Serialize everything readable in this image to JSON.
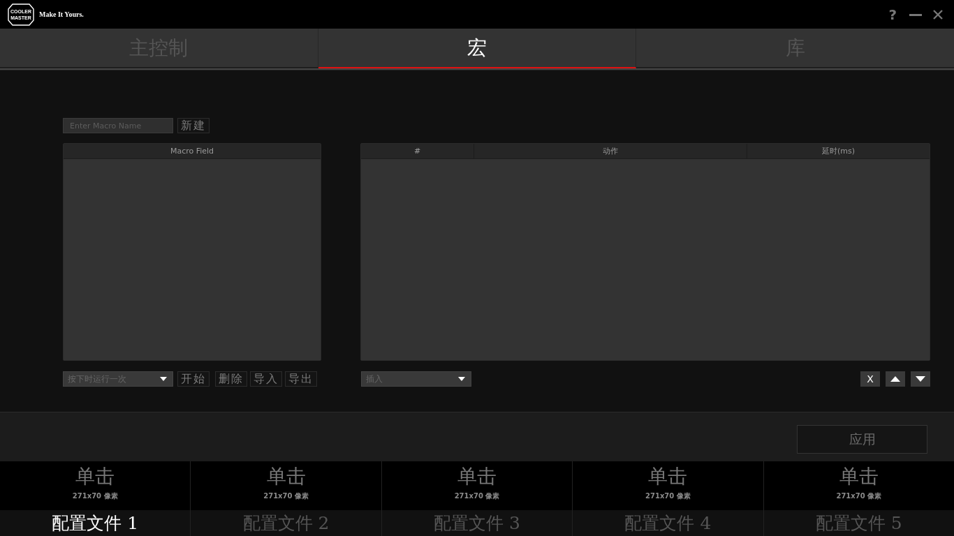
{
  "title_bar": {
    "logo_lines": [
      "COOLER",
      "MASTER"
    ],
    "slogan": "Make It Yours.",
    "help": "?"
  },
  "tabs": [
    {
      "label": "主控制",
      "selected": false
    },
    {
      "label": "宏",
      "selected": true
    },
    {
      "label": "库",
      "selected": false
    }
  ],
  "macro_name": {
    "placeholder": "Enter Macro Name"
  },
  "new_button": "新建",
  "macro_field": {
    "header": "Macro Field"
  },
  "run_mode": {
    "value": "按下时运行一次"
  },
  "macro_buttons": [
    "开始",
    "删除",
    "导入",
    "导出"
  ],
  "action_table": {
    "columns": [
      "#",
      "动作",
      "延时(ms)"
    ]
  },
  "insert_select": {
    "value": "插入"
  },
  "action_buttons": [
    {
      "kind": "text",
      "label": "X"
    },
    {
      "kind": "move_up"
    },
    {
      "kind": "move_down"
    }
  ],
  "apply_button": "应用",
  "profiles": [
    {
      "mode": "单击",
      "size": "271x70 像素",
      "label": "配置文件 1",
      "selected": true
    },
    {
      "mode": "单击",
      "size": "271x70 像素",
      "label": "配置文件 2",
      "selected": false
    },
    {
      "mode": "单击",
      "size": "271x70 像素",
      "label": "配置文件 3",
      "selected": false
    },
    {
      "mode": "单击",
      "size": "271x70 像素",
      "label": "配置文件 4",
      "selected": false
    },
    {
      "mode": "单击",
      "size": "271x70 像素",
      "label": "配置文件 5",
      "selected": false
    }
  ]
}
